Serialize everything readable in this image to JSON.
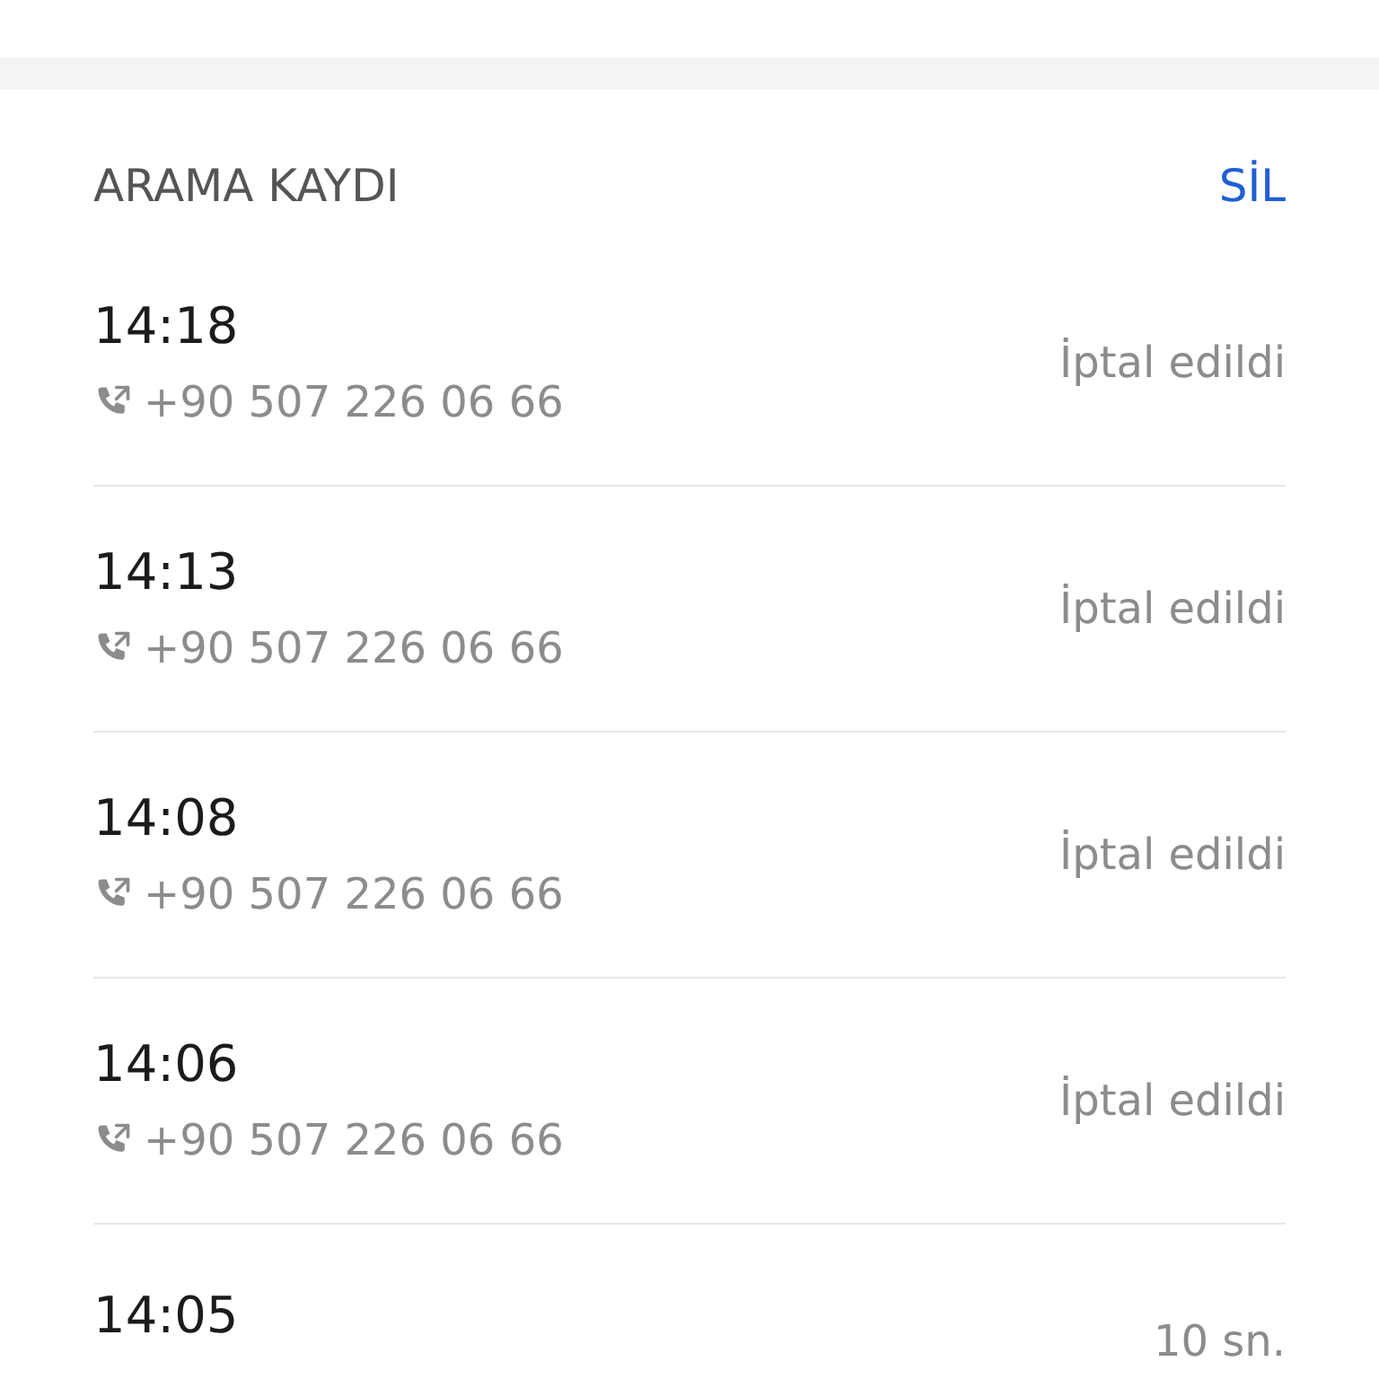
{
  "section": {
    "title": "ARAMA KAYDI",
    "action": "SİL"
  },
  "calls": [
    {
      "time": "14:18",
      "number": "+90 507 226 06 66",
      "status": "İptal edildi"
    },
    {
      "time": "14:13",
      "number": "+90 507 226 06 66",
      "status": "İptal edildi"
    },
    {
      "time": "14:08",
      "number": "+90 507 226 06 66",
      "status": "İptal edildi"
    },
    {
      "time": "14:06",
      "number": "+90 507 226 06 66",
      "status": "İptal edildi"
    },
    {
      "time": "14:05",
      "status": "10 sn."
    }
  ]
}
